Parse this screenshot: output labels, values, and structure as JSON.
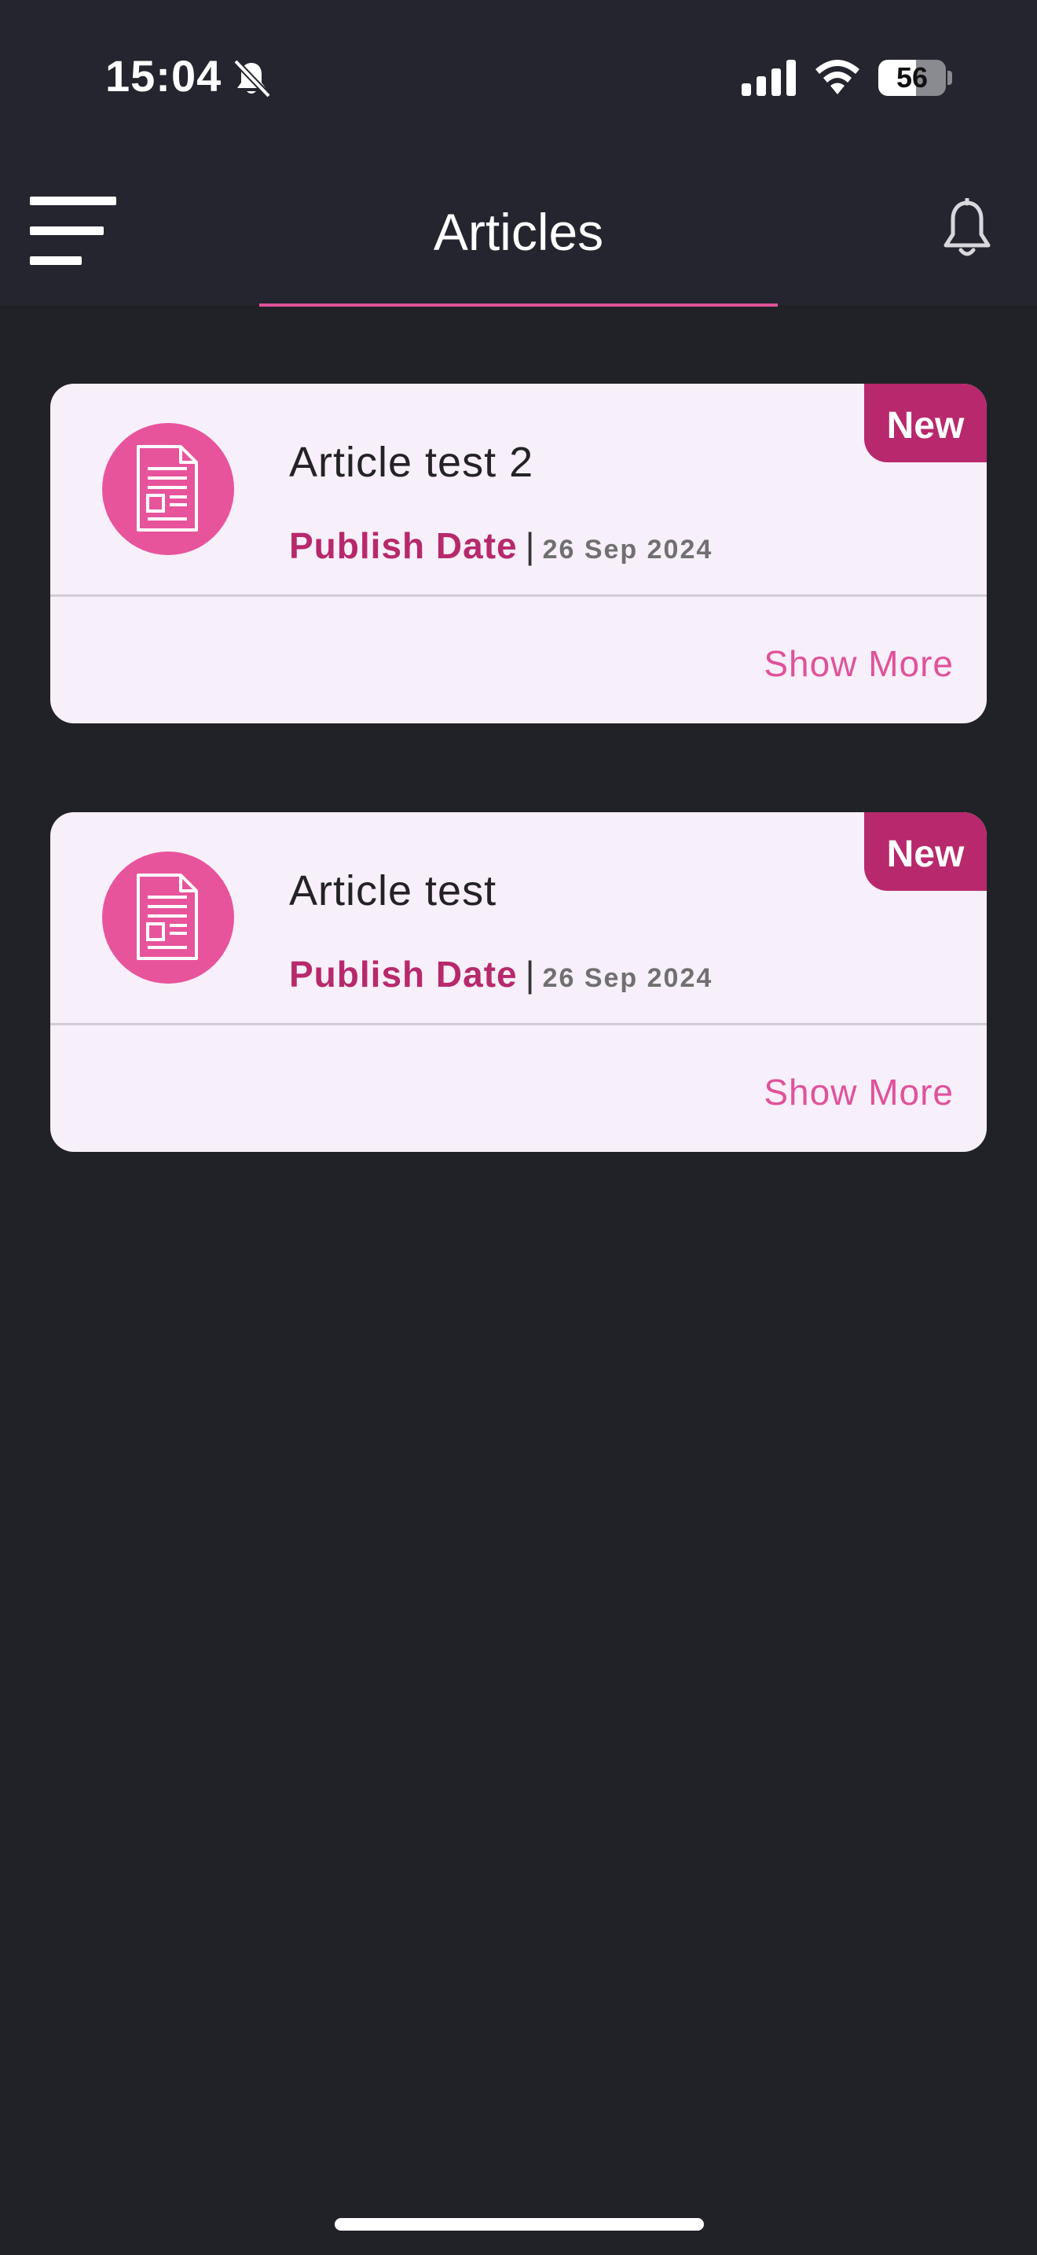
{
  "status_bar": {
    "time": "15:04",
    "battery_level": "56",
    "battery_fraction": 0.56,
    "icons": [
      "bell-slash-icon",
      "signal-icon",
      "wifi-icon",
      "battery-icon"
    ]
  },
  "header": {
    "title": "Articles",
    "menu_icon": "hamburger-menu-icon",
    "notification_icon": "bell-icon",
    "accent_color": "#e0529b"
  },
  "articles": [
    {
      "title": "Article test 2",
      "badge": "New",
      "publish_label": "Publish Date",
      "separator": "|",
      "publish_date": "26 Sep 2024",
      "action": "Show More",
      "icon": "document-icon"
    },
    {
      "title": "Article test",
      "badge": "New",
      "publish_label": "Publish Date",
      "separator": "|",
      "publish_date": "26 Sep 2024",
      "action": "Show More",
      "icon": "document-icon"
    }
  ],
  "colors": {
    "background": "#212227",
    "card": "#f7eff9",
    "badge": "#b8286c",
    "avatar": "#e8549c",
    "accent": "#e0529b"
  }
}
